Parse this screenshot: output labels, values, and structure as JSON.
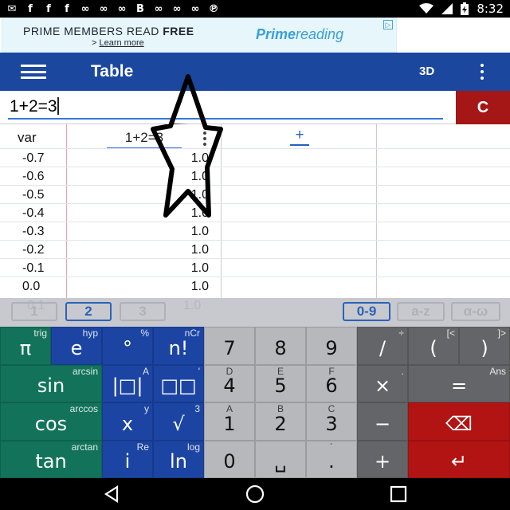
{
  "status_bar": {
    "notification_icons": [
      "messages-icon",
      "facebook-icon",
      "facebook-icon",
      "facebook-icon",
      "app-icon",
      "app-icon",
      "app-icon",
      "bitmoji-icon",
      "app-icon",
      "app-icon",
      "app-icon",
      "pinterest-icon"
    ],
    "notification_glyphs": [
      "✉",
      "f",
      "f",
      "f",
      "∞",
      "∞",
      "∞",
      "B",
      "∞",
      "∞",
      "∞",
      "℗"
    ],
    "wifi_icon": "wifi-icon",
    "signal_icon": "signal-icon",
    "battery_icon": "battery-charging-icon",
    "time": "8:32"
  },
  "ad": {
    "headline_plain": "PRIME MEMBERS READ ",
    "headline_bold": "FREE",
    "learn_prefix": "> ",
    "learn_more": "Learn more",
    "brand_bold": "Prime",
    "brand_plain": "reading",
    "adchoice_glyph": "▷",
    "brand_color": "#3aa0d6"
  },
  "app_bar": {
    "title": "Table",
    "view_3d": "3D",
    "background": "#1b479f"
  },
  "input": {
    "value": "1+2=3",
    "clear_label": "C"
  },
  "table": {
    "var_header": "var",
    "column_header": "1+2=3",
    "add_column": "+",
    "rows": [
      {
        "x": "-0.7",
        "y": "1.0"
      },
      {
        "x": "-0.6",
        "y": "1.0"
      },
      {
        "x": "-0.5",
        "y": "1.0"
      },
      {
        "x": "-0.4",
        "y": "1.0"
      },
      {
        "x": "-0.3",
        "y": "1.0"
      },
      {
        "x": "-0.2",
        "y": "1.0"
      },
      {
        "x": "-0.1",
        "y": "1.0"
      },
      {
        "x": "0.0",
        "y": "1.0"
      }
    ]
  },
  "pages": {
    "tabs": [
      "1",
      "2",
      "3"
    ],
    "active_tab": "2",
    "modes": [
      "0-9",
      "a-z",
      "α-ω"
    ],
    "active_mode": "0-9",
    "ghost_row": {
      "x": "0.1",
      "y": "1.0"
    }
  },
  "keypad": {
    "keys": [
      {
        "label": "π",
        "sub": "trig",
        "color": "green"
      },
      {
        "label": "e",
        "sub": "hyp",
        "color": "blue"
      },
      {
        "label": "°",
        "sub": "%",
        "color": "blue"
      },
      {
        "label": "n!",
        "sub": "nCr",
        "color": "blue"
      },
      {
        "label": "7",
        "sub": "",
        "color": "grey"
      },
      {
        "label": "8",
        "sub": "",
        "color": "grey"
      },
      {
        "label": "9",
        "sub": "",
        "color": "grey"
      },
      {
        "label": "/",
        "sub": "÷",
        "color": "dark"
      },
      {
        "label": "(",
        "sub": "[<",
        "color": "dark"
      },
      {
        "label": ")",
        "sub": "]>",
        "color": "dark"
      },
      {
        "label": "sin",
        "sub": "arcsin",
        "color": "green"
      },
      {
        "label": "|□|",
        "sub": "A",
        "color": "blue"
      },
      {
        "label": "□□",
        "sub": "'",
        "color": "blue"
      },
      {
        "label": "4",
        "sub": "D",
        "color": "grey"
      },
      {
        "label": "5",
        "sub": "E",
        "color": "grey"
      },
      {
        "label": "6",
        "sub": "F",
        "color": "grey"
      },
      {
        "label": "×",
        "sub": ".",
        "color": "dark"
      },
      {
        "label": "=",
        "sub": "Ans",
        "color": "dark"
      },
      {
        "label": "cos",
        "sub": "arccos",
        "color": "green"
      },
      {
        "label": "x",
        "sub": "y",
        "color": "blue"
      },
      {
        "label": "√",
        "sub": "3",
        "color": "blue"
      },
      {
        "label": "1",
        "sub": "A",
        "color": "grey"
      },
      {
        "label": "2",
        "sub": "B",
        "color": "grey"
      },
      {
        "label": "3",
        "sub": "C",
        "color": "grey"
      },
      {
        "label": "−",
        "sub": "",
        "color": "dark"
      },
      {
        "label": "⌫",
        "sub": "",
        "color": "red"
      },
      {
        "label": "tan",
        "sub": "arctan",
        "color": "green"
      },
      {
        "label": "i",
        "sub": "Re",
        "color": "blue"
      },
      {
        "label": "ln",
        "sub": "log",
        "color": "blue"
      },
      {
        "label": "0",
        "sub": "",
        "color": "grey"
      },
      {
        "label": "␣",
        "sub": "",
        "color": "grey"
      },
      {
        "label": ".",
        "sub": "´",
        "color": "grey"
      },
      {
        "label": "+",
        "sub": "",
        "color": "dark"
      },
      {
        "label": "↵",
        "sub": "",
        "color": "red"
      }
    ]
  },
  "nav_bar": {
    "back_icon": "back-icon",
    "home_icon": "home-icon",
    "recents_icon": "recents-icon"
  }
}
